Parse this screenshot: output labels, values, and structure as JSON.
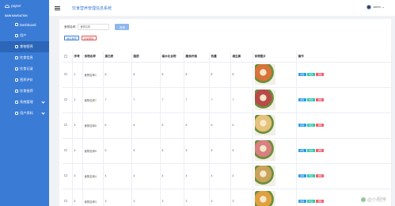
{
  "sidebar": {
    "logo_text": "paper",
    "section_title": "MAIN NAVIGATION",
    "items": [
      {
        "label": "Dashboard"
      },
      {
        "label": "用户"
      },
      {
        "label": "食物营养"
      },
      {
        "label": "饮食信息"
      },
      {
        "label": "饮食记录"
      },
      {
        "label": "营养评价"
      },
      {
        "label": "饮食推荐"
      },
      {
        "label": "系统管理"
      },
      {
        "label": "用户资料"
      }
    ]
  },
  "header": {
    "title": "饮食营养管理信息系统",
    "username": "admin"
  },
  "search": {
    "label": "食物名称",
    "placeholder": "食物名称",
    "button": "查询"
  },
  "actions": {
    "add": "添加食物",
    "batch_delete": "批量删除"
  },
  "table": {
    "headers": [
      "",
      "序号",
      "食物名称",
      "蛋白质",
      "脂肪",
      "碳水化合物",
      "膳食纤维",
      "热量",
      "维生素",
      "食物图片",
      "操作"
    ],
    "rows": [
      {
        "index": "1",
        "name": "食物名称1",
        "protein": "8",
        "fat": "8",
        "carb": "8",
        "fiber": "8",
        "energy": "8",
        "vitamin": "8",
        "image": "food-platter-1"
      },
      {
        "index": "2",
        "name": "食物名称7",
        "protein": "7",
        "fat": "7",
        "carb": "7",
        "fiber": "7",
        "energy": "7",
        "vitamin": "7",
        "image": "food-platter-2"
      },
      {
        "index": "3",
        "name": "食物名称6",
        "protein": "6",
        "fat": "6",
        "carb": "6",
        "fiber": "6",
        "energy": "6",
        "vitamin": "6",
        "image": "food-platter-3"
      },
      {
        "index": "4",
        "name": "食物名称5",
        "protein": "5",
        "fat": "5",
        "carb": "5",
        "fiber": "5",
        "energy": "5",
        "vitamin": "5",
        "image": "food-platter-4"
      },
      {
        "index": "5",
        "name": "食物名称4",
        "protein": "4",
        "fat": "4",
        "carb": "4",
        "fiber": "4",
        "energy": "4",
        "vitamin": "4",
        "image": "food-platter-5"
      },
      {
        "index": "6",
        "name": "食物名称3",
        "protein": "3",
        "fat": "3",
        "carb": "3",
        "fiber": "3",
        "energy": "3",
        "vitamin": "3",
        "image": "food-platter-6"
      }
    ],
    "ops": {
      "detail": "详情",
      "edit": "修改",
      "delete": "删除"
    }
  },
  "watermark": "@小程序",
  "colors": {
    "sidebar": "#3a7bd5",
    "sidebar_active": "#2c66b8",
    "primary": "#3a7bd5",
    "danger": "#e05050",
    "detail": "#2a9be8",
    "edit": "#2ec5a6",
    "delete": "#ef5b6d",
    "food_images": [
      "#d9733a",
      "#b84a4a",
      "#e6c27a",
      "#d98080",
      "#c9a25c",
      "#e0a040"
    ]
  }
}
